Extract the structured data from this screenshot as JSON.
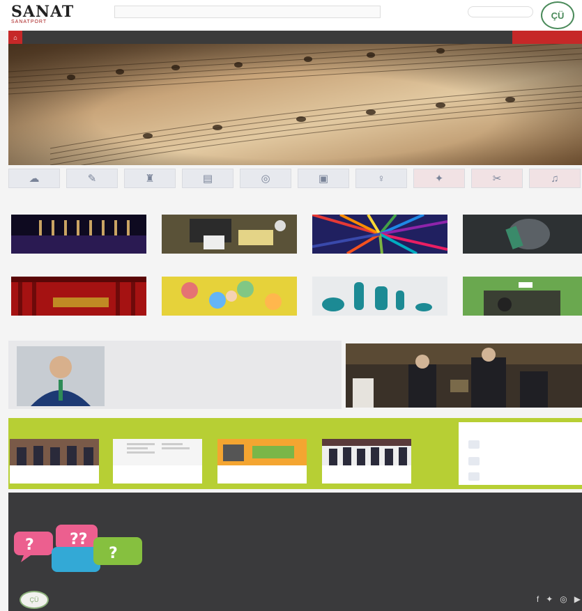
{
  "brand": {
    "logo_text": "SANAT",
    "logo_sub": "SANATPORT",
    "seal_text": "ÇÜ"
  },
  "top": {
    "search_text": "",
    "lang_text": ""
  },
  "nav": {
    "home_icon": "home-icon",
    "items": [
      "",
      "",
      "",
      "",
      "",
      "",
      ""
    ],
    "cta": ""
  },
  "icons": [
    {
      "name": "theatre-icon"
    },
    {
      "name": "brush-icon"
    },
    {
      "name": "sculpture-icon"
    },
    {
      "name": "music-icon"
    },
    {
      "name": "cinema-icon"
    },
    {
      "name": "camera-icon"
    },
    {
      "name": "literature-icon"
    },
    {
      "name": "dance-icon"
    },
    {
      "name": "scissors-icon"
    },
    {
      "name": "notes-icon"
    }
  ],
  "section": {
    "title": "",
    "more": ""
  },
  "tiles": [
    {
      "caption": ""
    },
    {
      "caption": ""
    },
    {
      "caption": ""
    },
    {
      "caption": ""
    },
    {
      "caption": ""
    },
    {
      "caption": ""
    },
    {
      "caption": ""
    },
    {
      "caption": ""
    }
  ],
  "profile": {
    "name": "",
    "description": "",
    "link": ""
  },
  "news": {
    "title": "",
    "more": "",
    "items": [
      {
        "caption": ""
      },
      {
        "caption": ""
      },
      {
        "caption": ""
      },
      {
        "caption": ""
      }
    ]
  },
  "events": {
    "title": "",
    "more": "",
    "items": [
      {
        "text": ""
      },
      {
        "text": ""
      },
      {
        "text": ""
      }
    ]
  },
  "footer": {
    "phone": "",
    "email": "",
    "address": "",
    "col1": {
      "title": "",
      "links": [
        "",
        "",
        "",
        "",
        "",
        "",
        "",
        "",
        ""
      ]
    },
    "col2": {
      "title": "",
      "links": [
        "",
        "",
        "",
        "",
        "",
        "",
        "",
        ""
      ]
    },
    "copyright": "",
    "credit": "",
    "social": [
      "facebook-icon",
      "twitter-icon",
      "instagram-icon",
      "youtube-icon"
    ]
  },
  "colors": {
    "accent_red": "#c62828",
    "lime": "#b7cf34",
    "footer_bg": "#3a3a3c",
    "nav_bg": "#3b3b3b"
  }
}
